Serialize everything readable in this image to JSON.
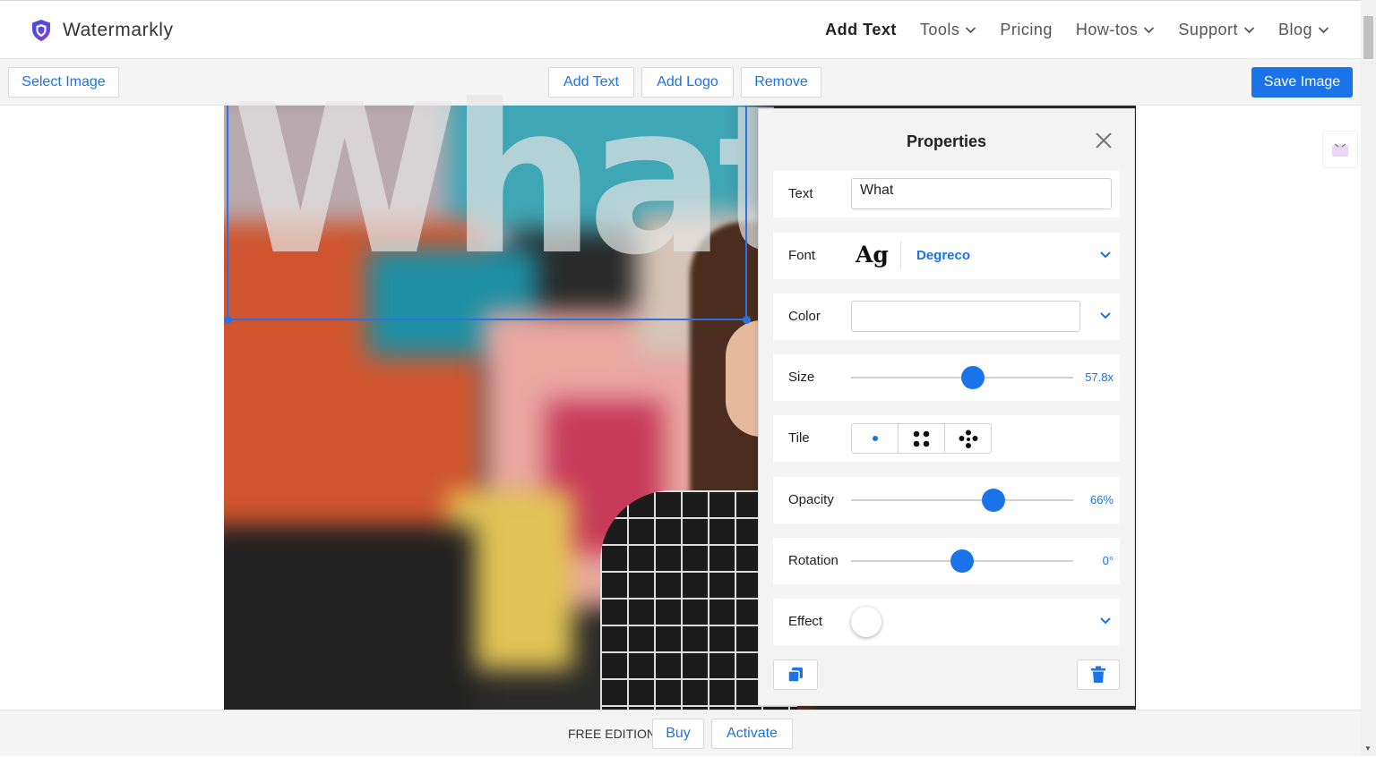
{
  "app": {
    "name": "Watermarkly"
  },
  "nav": [
    {
      "label": "Add Text",
      "dropdown": false,
      "active": true
    },
    {
      "label": "Tools",
      "dropdown": true
    },
    {
      "label": "Pricing",
      "dropdown": false
    },
    {
      "label": "How-tos",
      "dropdown": true
    },
    {
      "label": "Support",
      "dropdown": true
    },
    {
      "label": "Blog",
      "dropdown": true
    }
  ],
  "toolbar": {
    "select_image": "Select Image",
    "add_text": "Add Text",
    "add_logo": "Add Logo",
    "remove": "Remove",
    "save_image": "Save Image"
  },
  "canvas": {
    "watermark_text": "What"
  },
  "properties": {
    "title": "Properties",
    "text": {
      "label": "Text",
      "value": "What"
    },
    "font": {
      "label": "Font",
      "preview": "Ag",
      "value": "Degreco"
    },
    "color": {
      "label": "Color"
    },
    "size": {
      "label": "Size",
      "value": "57.8x",
      "fraction": 0.55
    },
    "tile": {
      "label": "Tile",
      "options": [
        "single",
        "grid-4",
        "scatter-5"
      ],
      "selected": "single"
    },
    "opacity": {
      "label": "Opacity",
      "value": "66%",
      "fraction": 0.64
    },
    "rotation": {
      "label": "Rotation",
      "value": "0°",
      "fraction": 0.5
    },
    "effect": {
      "label": "Effect"
    }
  },
  "footer": {
    "edition": "FREE EDITION",
    "buy": "Buy",
    "activate": "Activate"
  },
  "colors": {
    "accent": "#1a73e8",
    "selection": "#2f6fe0",
    "logo_purple": "#5b3fd6"
  }
}
